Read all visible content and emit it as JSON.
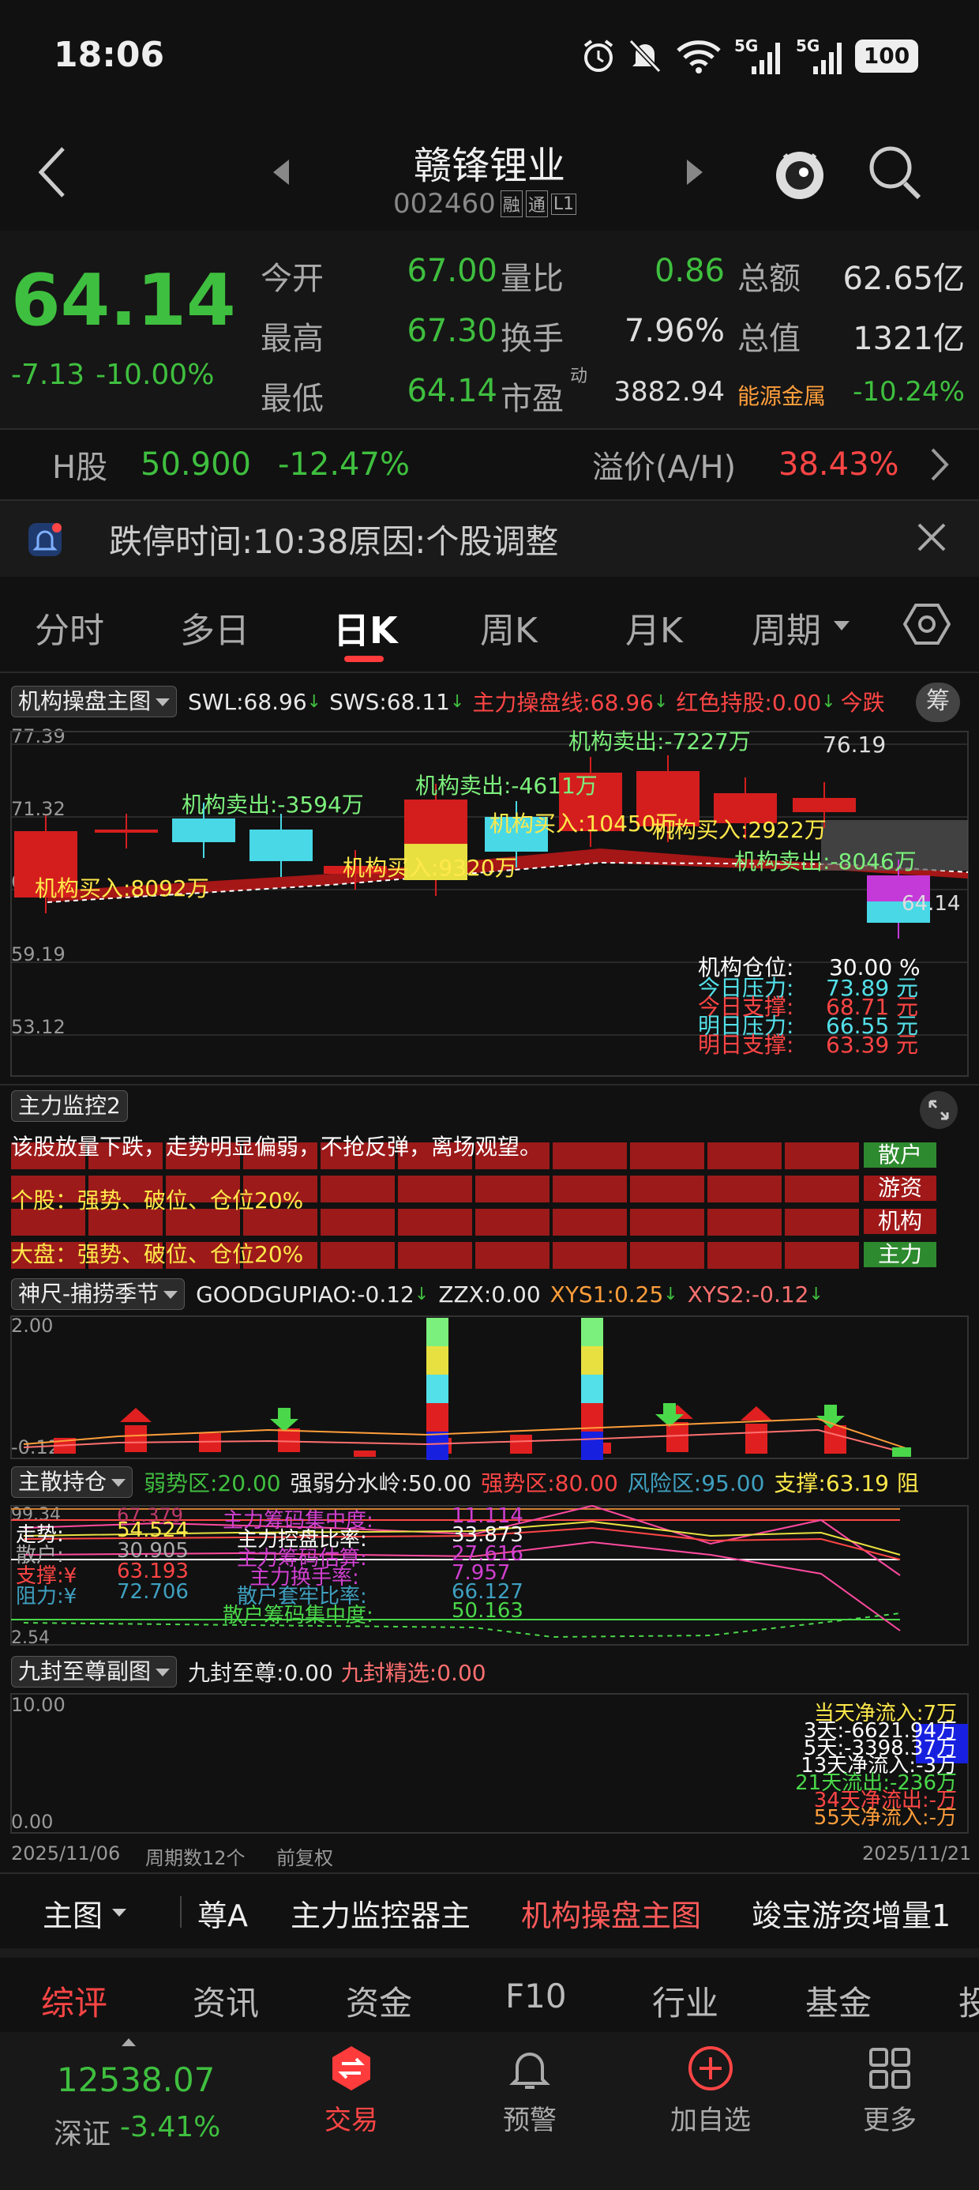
{
  "status": {
    "time": "18:06",
    "net1": "5G",
    "net2": "5G",
    "battery": "100"
  },
  "header": {
    "title": "赣锋锂业",
    "code": "002460",
    "badges": [
      "融",
      "通",
      "L1"
    ]
  },
  "quote": {
    "price": "64.14",
    "change": "-7.13",
    "change_pct": "-10.00%",
    "f": [
      [
        "今开",
        "67.00",
        "量比",
        "0.86",
        "总额",
        "62.65亿"
      ],
      [
        "最高",
        "67.30",
        "换手",
        "7.96%",
        "总值",
        "1321亿"
      ],
      [
        "最低",
        "64.14",
        "市盈",
        "3882.94",
        "能源金属",
        "-10.24%"
      ]
    ],
    "pe_sup": "动"
  },
  "hshare": {
    "label": "H股",
    "price": "50.900",
    "pct": "-12.47%",
    "prem_label": "溢价(A/H)",
    "prem": "38.43%"
  },
  "notice": {
    "text": "跌停时间:10:38原因:个股调整"
  },
  "tabs": [
    "分时",
    "多日",
    "日K",
    "周K",
    "月K",
    "周期"
  ],
  "main": {
    "sel": "机构操盘主图",
    "v1": "SWL:68.96",
    "v2": "SWS:68.11",
    "v3": "主力操盘线:68.96",
    "v4": "红色持股:0.00",
    "v5": "今跌",
    "btn": "筹",
    "yt": [
      "77.39",
      "71.32",
      "65.26",
      "59.19",
      "53.12"
    ],
    "labels": [
      "机构买入:8092万",
      "机构卖出:-3594万",
      "机构买入:9320万",
      "机构卖出:-4611万",
      "机构卖出:-7227万",
      "机构买入:10450万",
      "机构买入:2922万",
      "机构卖出:-8046万"
    ],
    "hi": "76.19",
    "lo": "64.14",
    "cang_l": "机构仓位:",
    "cang_v": "30.00 %",
    "pr": [
      [
        "今日压力:",
        "73.89 元"
      ],
      [
        "今日支撑:",
        "68.71 元"
      ],
      [
        "明日压力:",
        "66.55 元"
      ],
      [
        "明日支撑:",
        "63.39 元"
      ]
    ]
  },
  "jk": {
    "sel": "主力监控2",
    "lines": [
      "该股放量下跌，走势明显偏弱，不抢反弹，离场观望。",
      "个股：强势、破位、仓位20%",
      "大盘：强势、破位、仓位20%"
    ],
    "tags": [
      "散户",
      "游资",
      "机构",
      "主力"
    ]
  },
  "sc": {
    "sel": "神尺-捕捞季节",
    "v1": "GOODGUPIAO:-0.12",
    "v2": "ZZX:0.00",
    "v3": "XYS1:0.25",
    "v4": "XYS2:-0.12",
    "yt": [
      "2.00",
      "-0.12"
    ]
  },
  "zs": {
    "sel": "主散持仓",
    "v1": "弱势区:20.00",
    "v2": "强弱分水岭:50.00",
    "v3": "强势区:80.00",
    "v4": "风险区:95.00",
    "v5": "支撑:63.19",
    "v6": "阻",
    "yt": [
      "99.34",
      "2.54"
    ],
    "left": [
      [
        "走势:",
        "54.524"
      ],
      [
        "散户:",
        "30.905"
      ],
      [
        "支撑:¥",
        "63.193"
      ],
      [
        "阻力:¥",
        "72.706"
      ]
    ],
    "mid": [
      [
        "主力筹码集中度:",
        "11.114"
      ],
      [
        "主力控盘比率:",
        "33.873"
      ],
      [
        "主力筹码估算:",
        "27.616"
      ],
      [
        "主力换手率:",
        "7.957"
      ],
      [
        "散户套牢比率:",
        "66.127"
      ],
      [
        "散户筹码集中度:",
        "50.163"
      ]
    ],
    "top_left": "67.379"
  },
  "jf": {
    "sel": "九封至尊副图",
    "v1": "九封至尊:0.00",
    "v2": "九封精选:0.00",
    "yt": [
      "10.00",
      "0.00"
    ],
    "rt": [
      "当天净流入:7万",
      "3天:-6621.94万",
      "5天:-3398.37万",
      "13天净流入:-3万",
      "21天流出:-236万",
      "34天净流出:-万",
      "55天净流入:-万"
    ],
    "d1": "2025/11/06",
    "d2": "周期数12个",
    "d3": "前复权",
    "d4": "2025/11/21"
  },
  "subtabs": [
    "主图",
    "尊A",
    "主力监控器主",
    "机构操盘主图",
    "竣宝游资增量1"
  ],
  "bottom_tabs": [
    "综评",
    "资讯",
    "资金",
    "F10",
    "行业",
    "基金",
    "投"
  ],
  "nav": {
    "index_val": "12538.07",
    "index_name": "深证",
    "index_pct": "-3.41%",
    "items": [
      "交易",
      "预警",
      "加自选",
      "更多"
    ]
  }
}
